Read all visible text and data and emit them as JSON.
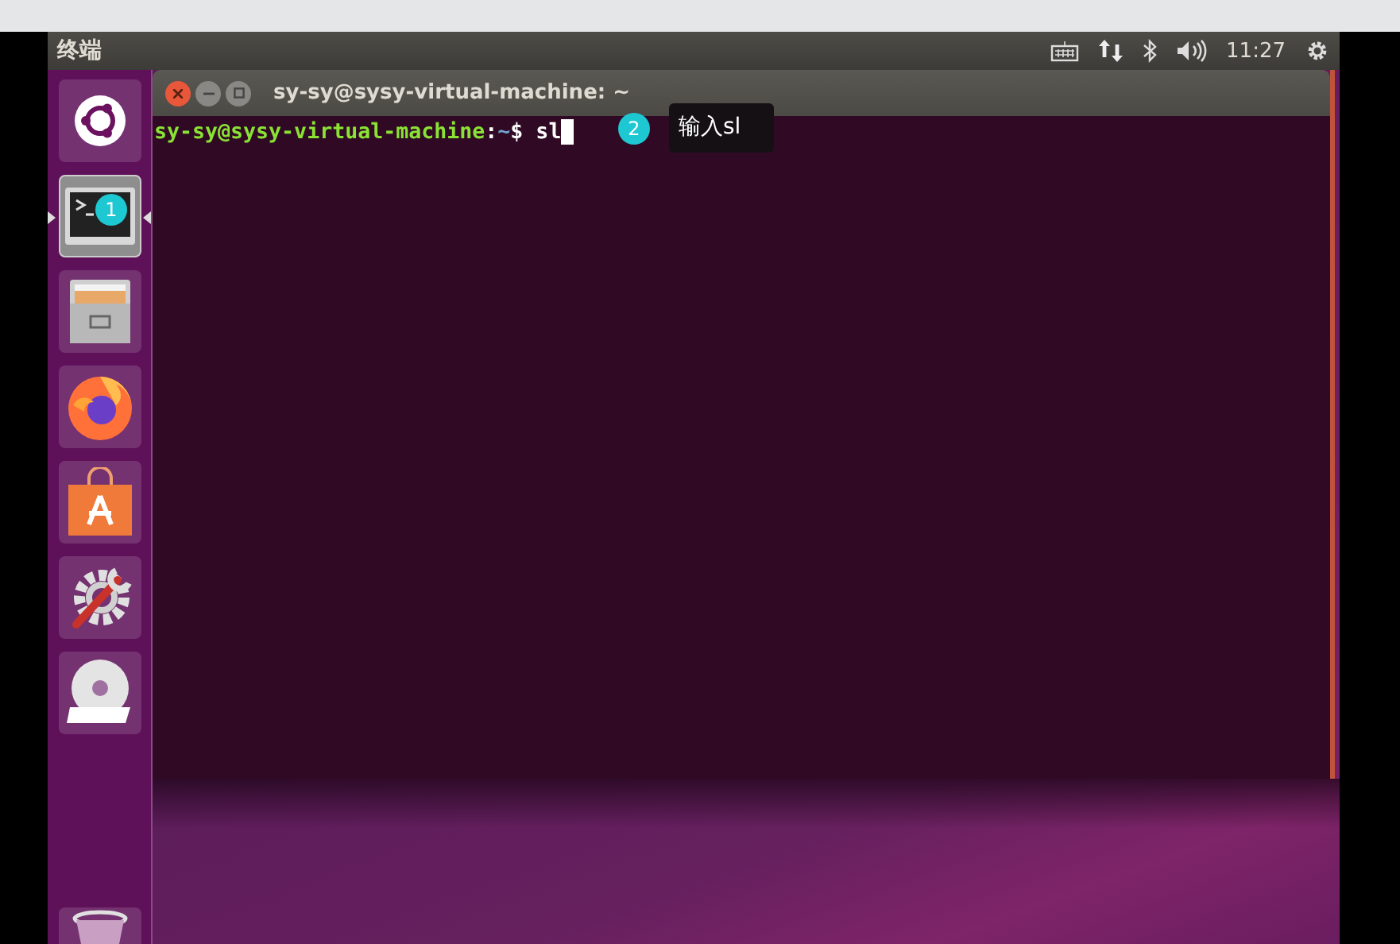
{
  "top_panel": {
    "title": "终端",
    "clock": "11:27"
  },
  "launcher": {
    "items": [
      {
        "kind": "ubuntu",
        "selected": false
      },
      {
        "kind": "terminal",
        "selected": true
      },
      {
        "kind": "files",
        "selected": false
      },
      {
        "kind": "browser",
        "selected": false
      },
      {
        "kind": "store",
        "selected": false
      },
      {
        "kind": "settings",
        "selected": false
      },
      {
        "kind": "dvd",
        "selected": false
      },
      {
        "kind": "trash",
        "selected": false
      }
    ]
  },
  "terminal": {
    "title": "sy-sy@sysy-virtual-machine: ~",
    "line": [
      {
        "kind": "userhost",
        "text": "sy-sy@sysy-virtual-machine"
      },
      {
        "kind": "plain",
        "text": ":"
      },
      {
        "kind": "path",
        "text": "~"
      },
      {
        "kind": "plain",
        "text": "$ sl"
      }
    ]
  },
  "annotations": [
    {
      "number": "1"
    },
    {
      "number": "2",
      "note": "输入sl"
    }
  ]
}
